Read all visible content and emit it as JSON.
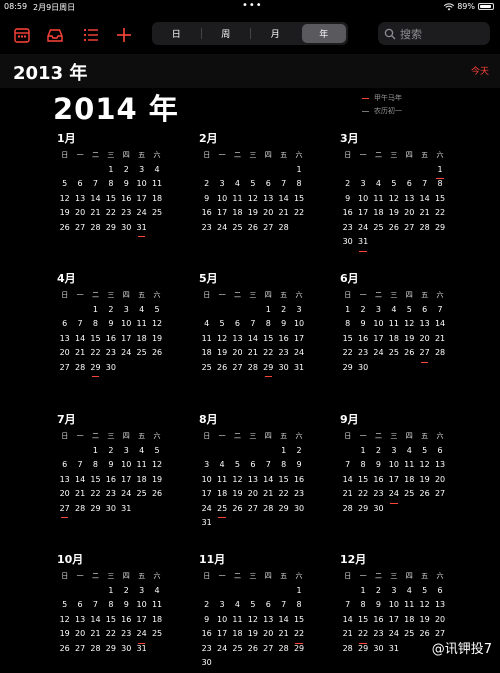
{
  "status_bar": {
    "time": "08:59",
    "date": "2月9日周日",
    "battery": "89%",
    "battery_level": 0.89
  },
  "toolbar": {
    "segments": [
      {
        "label": "日",
        "active": false
      },
      {
        "label": "周",
        "active": false
      },
      {
        "label": "月",
        "active": false
      },
      {
        "label": "年",
        "active": true
      }
    ],
    "search_placeholder": "搜索",
    "accent": "#ff453a"
  },
  "header": {
    "year_title": "2013 年",
    "today_label": "今天"
  },
  "main": {
    "year_title": "2014 年",
    "legend": [
      "甲午马年",
      "农历初一"
    ],
    "weekdays": [
      "日",
      "一",
      "二",
      "三",
      "四",
      "五",
      "六"
    ],
    "months": [
      {
        "name": "1月",
        "start": 3,
        "days": 31,
        "marked": [
          31
        ]
      },
      {
        "name": "2月",
        "start": 6,
        "days": 28,
        "marked": []
      },
      {
        "name": "3月",
        "start": 6,
        "days": 31,
        "marked": [
          1,
          31
        ]
      },
      {
        "name": "4月",
        "start": 2,
        "days": 30,
        "marked": [
          29
        ]
      },
      {
        "name": "5月",
        "start": 4,
        "days": 31,
        "marked": [
          29
        ]
      },
      {
        "name": "6月",
        "start": 0,
        "days": 30,
        "marked": [
          27
        ]
      },
      {
        "name": "7月",
        "start": 2,
        "days": 31,
        "marked": [
          27
        ]
      },
      {
        "name": "8月",
        "start": 5,
        "days": 31,
        "marked": [
          25
        ]
      },
      {
        "name": "9月",
        "start": 1,
        "days": 30,
        "marked": [
          24
        ]
      },
      {
        "name": "10月",
        "start": 3,
        "days": 31,
        "marked": [
          24
        ]
      },
      {
        "name": "11月",
        "start": 6,
        "days": 30,
        "marked": [
          22
        ]
      },
      {
        "name": "12月",
        "start": 1,
        "days": 31,
        "marked": [
          22
        ]
      }
    ]
  },
  "watermark": "@讯钾投7"
}
